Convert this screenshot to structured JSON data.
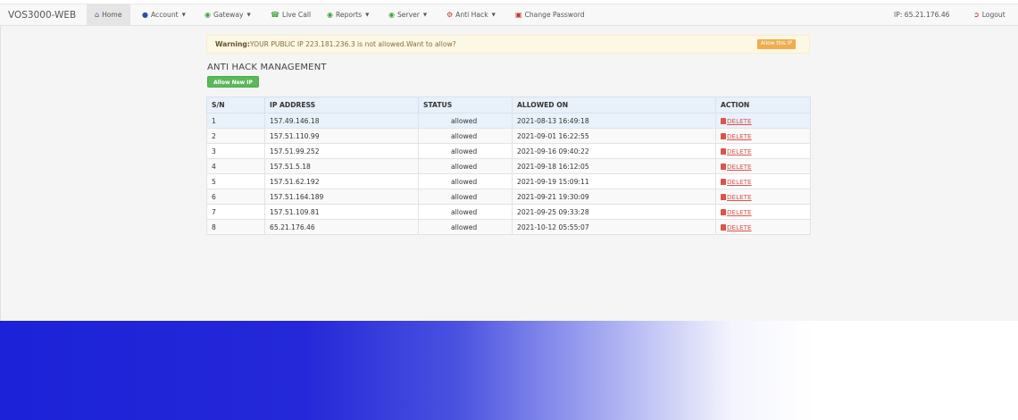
{
  "brand": "VOS3000-WEB",
  "nav": {
    "home": "Home",
    "account": "Account",
    "gateway": "Gateway",
    "live_call": "Live Call",
    "reports": "Reports",
    "server": "Server",
    "anti_hack": "Anti Hack",
    "change_password": "Change Password",
    "ip_info": "IP: 65.21.176.46",
    "logout": "Logout"
  },
  "warning": {
    "label": "Warning:",
    "message": "YOUR PUBLIC IP 223.181.236.3 is not allowed.Want to allow?",
    "button": "Allow this IP"
  },
  "page_title": "ANTI HACK MANAGEMENT",
  "allow_new_button": "Allow New IP",
  "table": {
    "headers": [
      "S/N",
      "IP ADDRESS",
      "STATUS",
      "ALLOWED ON",
      "ACTION"
    ],
    "rows": [
      {
        "sn": "1",
        "ip": "157.49.146.18",
        "status": "allowed",
        "allowed_on": "2021-08-13 16:49:18",
        "action": "DELETE"
      },
      {
        "sn": "2",
        "ip": "157.51.110.99",
        "status": "allowed",
        "allowed_on": "2021-09-01 16:22:55",
        "action": "DELETE"
      },
      {
        "sn": "3",
        "ip": "157.51.99.252",
        "status": "allowed",
        "allowed_on": "2021-09-16 09:40:22",
        "action": "DELETE"
      },
      {
        "sn": "4",
        "ip": "157.51.5.18",
        "status": "allowed",
        "allowed_on": "2021-09-18 16:12:05",
        "action": "DELETE"
      },
      {
        "sn": "5",
        "ip": "157.51.62.192",
        "status": "allowed",
        "allowed_on": "2021-09-19 15:09:11",
        "action": "DELETE"
      },
      {
        "sn": "6",
        "ip": "157.51.164.189",
        "status": "allowed",
        "allowed_on": "2021-09-21 19:30:09",
        "action": "DELETE"
      },
      {
        "sn": "7",
        "ip": "157.51.109.81",
        "status": "allowed",
        "allowed_on": "2021-09-25 09:33:28",
        "action": "DELETE"
      },
      {
        "sn": "8",
        "ip": "65.21.176.46",
        "status": "allowed",
        "allowed_on": "2021-10-12 05:55:07",
        "action": "DELETE"
      }
    ]
  },
  "colors": {
    "success": "#5cb85c",
    "warning": "#f0ad4e",
    "danger": "#d9534f",
    "banner_blue": "#1c22d8"
  },
  "icons": {
    "home": "home-icon",
    "account": "user-icon",
    "gateway": "globe-icon",
    "live_call": "phone-icon",
    "reports": "globe-icon",
    "server": "globe-icon",
    "anti_hack": "gear-icon",
    "change_password": "lock-icon",
    "logout": "logout-icon",
    "delete": "trash-icon"
  }
}
